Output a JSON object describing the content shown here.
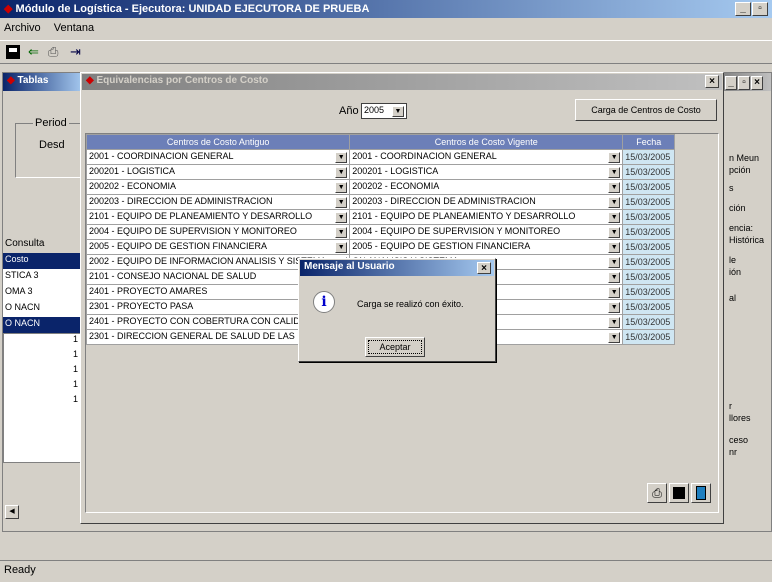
{
  "app": {
    "title": "Módulo de Logística - Ejecutora: UNIDAD EJECUTORA DE PRUEBA",
    "menu": [
      "Archivo",
      "Ventana"
    ],
    "status": "Ready"
  },
  "bg_window": {
    "title": "Tablas",
    "periodo_label": "Period",
    "desde_label": "Desd",
    "consulta_label": "Consulta",
    "rows": [
      "Costo",
      "STICA 3",
      "OMA 3",
      "O NACN",
      "O NACN"
    ],
    "numbers": [
      "1",
      "1",
      "1",
      "1",
      "1"
    ],
    "right_items": [
      "n Meun",
      "pción",
      "s",
      "ción",
      "encia:",
      "Histórica",
      "le",
      "ión",
      "al",
      "r",
      "llores",
      "ceso",
      "nr"
    ]
  },
  "dialog": {
    "title": "Equivalencias por Centros de Costo",
    "year_label": "Año",
    "year_value": "2005",
    "load_button": "Carga de Centros de Costo",
    "headers": [
      "Centros de Costo Antiguo",
      "Centros de Costo Vigente",
      "Fecha"
    ],
    "rows": [
      [
        "2001 - COORDINACION GENERAL",
        "2001 - COORDINACION GENERAL",
        "15/03/2005"
      ],
      [
        "200201 - LOGISTICA",
        "200201 - LOGISTICA",
        "15/03/2005"
      ],
      [
        "200202 - ECONOMIA",
        "200202 - ECONOMIA",
        "15/03/2005"
      ],
      [
        "200203 - DIRECCION DE ADMINISTRACION",
        "200203 - DIRECCION DE ADMINISTRACION",
        "15/03/2005"
      ],
      [
        "2101 - EQUIPO DE PLANEAMIENTO Y DESARROLLO",
        "2101 - EQUIPO DE PLANEAMIENTO Y DESARROLLO",
        "15/03/2005"
      ],
      [
        "2004 - EQUIPO DE SUPERVISION Y MONITOREO",
        "2004 - EQUIPO DE SUPERVISION Y MONITOREO",
        "15/03/2005"
      ],
      [
        "2005 - EQUIPO DE GESTION FINANCIERA",
        "2005 - EQUIPO DE GESTION FINANCIERA",
        "15/03/2005"
      ],
      [
        "2002 - EQUIPO DE INFORMACION ANALISIS Y SISTEMA",
        "ON ANALISIS Y SISTEMA",
        "15/03/2005"
      ],
      [
        "2101 - CONSEJO NACIONAL DE SALUD",
        "E SALUD",
        "15/03/2005"
      ],
      [
        "2401 - PROYECTO AMARES",
        "",
        "15/03/2005"
      ],
      [
        "2301 - PROYECTO PASA",
        "",
        "15/03/2005"
      ],
      [
        "2401 - PROYECTO CON COBERTURA CON CALIDAD",
        "RTURA CON CALIDAD",
        "15/03/2005"
      ],
      [
        "2301 - DIRECCION GENERAL DE SALUD DE LAS PERSONAS",
        "O SALUD DE LAS PERS",
        "15/03/2005"
      ]
    ]
  },
  "message": {
    "title": "Mensaje al Usuario",
    "text": "Carga se realizó con éxito.",
    "accept": "Aceptar"
  }
}
